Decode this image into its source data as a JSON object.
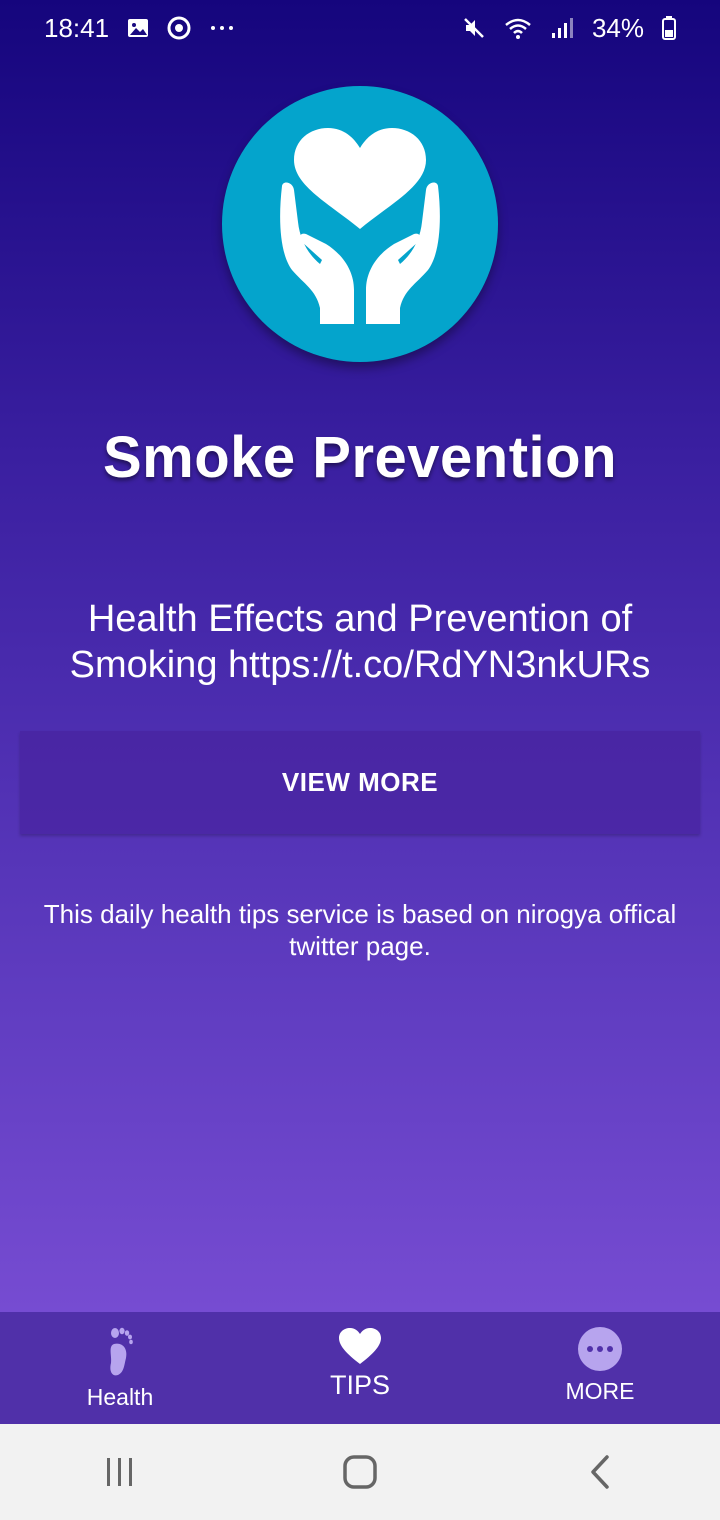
{
  "status_bar": {
    "time": "18:41",
    "battery": "34%",
    "left_icons": [
      "gallery-icon",
      "chrome-icon",
      "more-dots-icon"
    ],
    "right_icons": [
      "mute-icon",
      "wifi-icon",
      "signal-icon",
      "battery-icon"
    ]
  },
  "logo": {
    "icon": "heart-hands-icon",
    "color": "#04a4cc"
  },
  "main": {
    "title": "Smoke Prevention",
    "tip": "Health Effects and Prevention of Smoking https://t.co/RdYN3nkURs",
    "view_more_label": "VIEW MORE",
    "info": "This daily health tips service is based on nirogya offical twitter page."
  },
  "bottom_nav": {
    "items": [
      {
        "label": "Health",
        "icon": "footprint-icon",
        "active": false
      },
      {
        "label": "TIPS",
        "icon": "heart-icon",
        "active": true
      },
      {
        "label": "MORE",
        "icon": "more-circle-icon",
        "active": false
      }
    ]
  },
  "system_nav": [
    "recents-button",
    "home-button",
    "back-button"
  ],
  "colors": {
    "gradient_top": "#15057d",
    "gradient_bottom": "#8556dd",
    "nav_background": "#5030a9",
    "inactive_icon": "#b7a4ee"
  }
}
